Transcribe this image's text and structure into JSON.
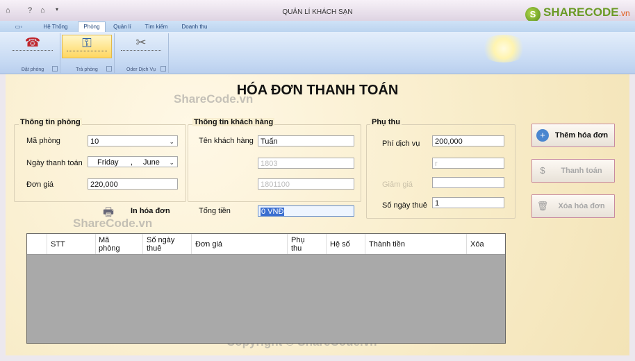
{
  "app": {
    "title": "QUẢN LÍ KHÁCH SẠN",
    "logo": "SHARECODE",
    "logo_suffix": ".vn",
    "logo_badge": "S"
  },
  "ribbon": {
    "tabs": [
      "Hệ Thống",
      "Phòng",
      "Quản lí",
      "Tìm kiếm",
      "Doanh thu"
    ],
    "active_tab": "Phòng",
    "groups": [
      {
        "label": "Đặt phòng",
        "icon": "telephone-icon"
      },
      {
        "label": "Trả phòng",
        "icon": "key-tag-icon"
      },
      {
        "label": "Oder Dịch Vụ",
        "icon": "tools-icon"
      }
    ]
  },
  "form": {
    "title": "HÓA ĐƠN THANH TOÁN",
    "room_info": {
      "title": "Thông tin phòng",
      "room_no_label": "Mã phòng",
      "room_no": "10",
      "checkout_label": "Ngày thanh toán",
      "checkout_day": "Friday",
      "checkout_sep": ",",
      "checkout_month": "June",
      "price_label": "Đơn giá",
      "price": "220,000"
    },
    "customer_info": {
      "title": "Thông tin khách hàng",
      "name_label": "Tên khách hàng",
      "name": "Tuấn",
      "hidden_value_1": "1803",
      "hidden_value_2": "1801100"
    },
    "surcharge": {
      "title": "Phụ thu",
      "service_fee_label": "Phí dịch vụ",
      "service_fee": "200,000",
      "hidden_value": "r",
      "hidden_label": "Giảm giá",
      "days_label": "Số ngày thuê",
      "days": "1"
    },
    "print_label": "In hóa đơn",
    "total_label": "Tổng tiền",
    "total_value": "0 VNĐ"
  },
  "actions": {
    "add": "Thêm hóa đơn",
    "pay": "Thanh toán",
    "delete": "Xóa hóa đơn"
  },
  "grid": {
    "columns": [
      "STT",
      "Mã phòng",
      "Số ngày thuê",
      "Đơn giá",
      "Phụ thu",
      "Hệ số",
      "Thành tiền",
      "Xóa"
    ]
  },
  "watermarks": {
    "text": "ShareCode.vn",
    "copyright": "Copyright © ShareCode.vn"
  },
  "colors": {
    "ribbon_accent": "#ffd760",
    "form_background": "#f8ecc8",
    "grid_background": "#a9a9a9"
  }
}
